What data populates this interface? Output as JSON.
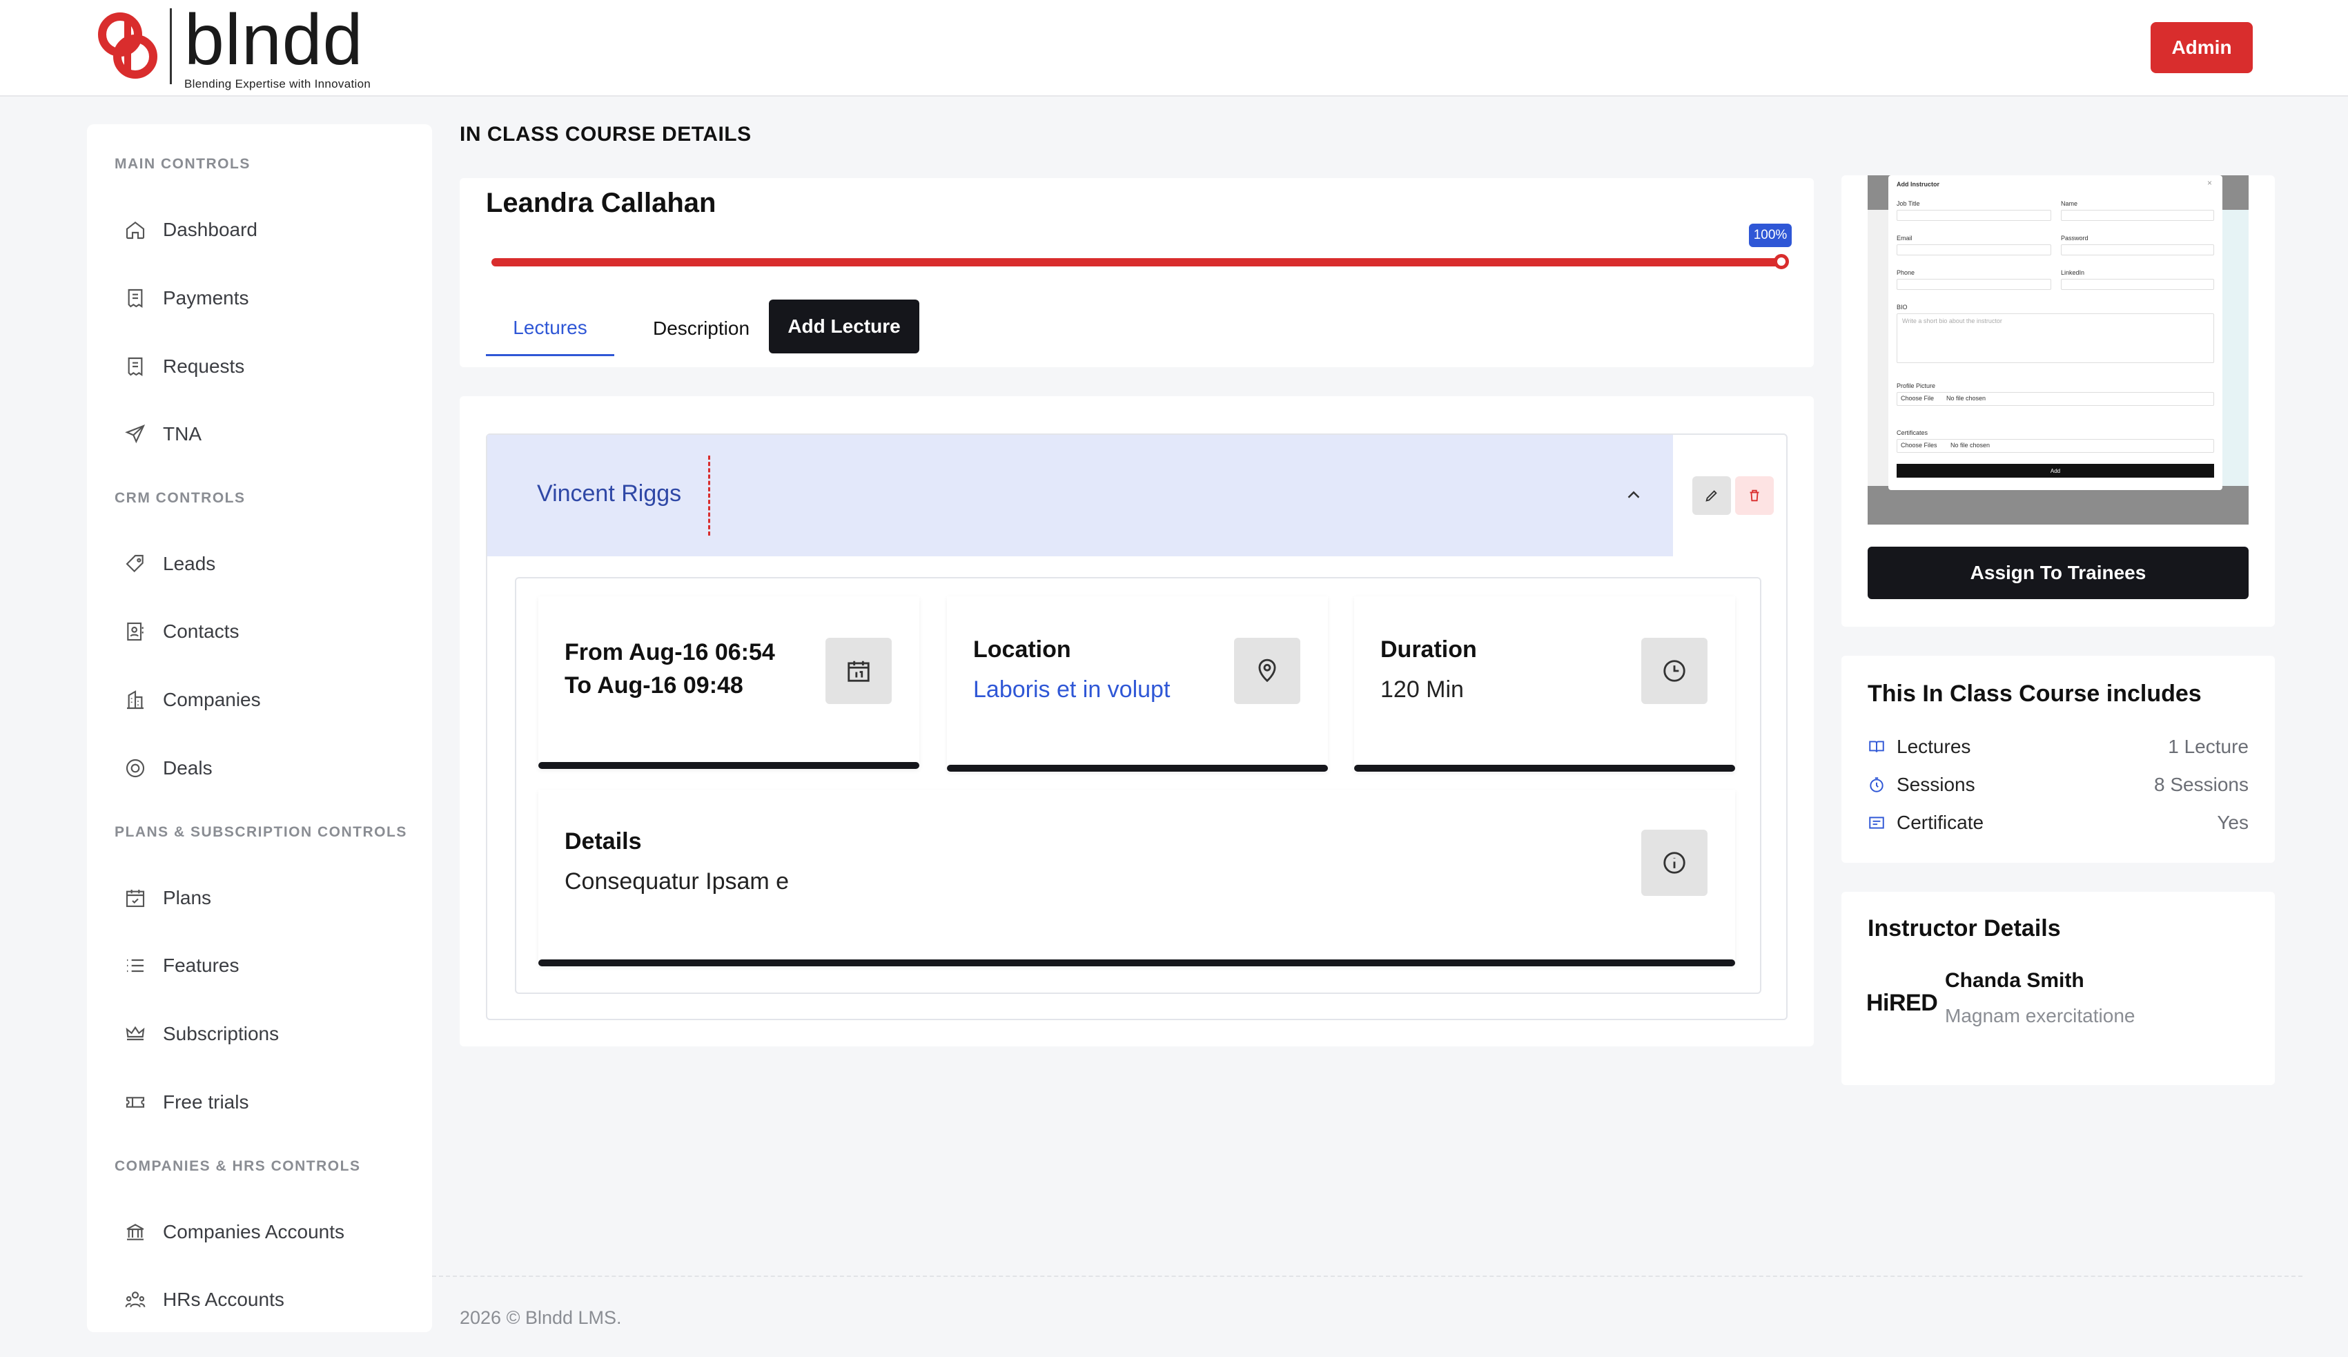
{
  "header": {
    "brand": "blndd",
    "tagline": "Blending Expertise with Innovation",
    "admin_label": "Admin"
  },
  "sidebar": {
    "sections": [
      {
        "title": "MAIN CONTROLS",
        "items": [
          "Dashboard",
          "Payments",
          "Requests",
          "TNA"
        ]
      },
      {
        "title": "CRM CONTROLS",
        "items": [
          "Leads",
          "Contacts",
          "Companies",
          "Deals"
        ]
      },
      {
        "title": "PLANS & SUBSCRIPTION CONTROLS",
        "items": [
          "Plans",
          "Features",
          "Subscriptions",
          "Free trials"
        ]
      },
      {
        "title": "COMPANIES & HRS CONTROLS",
        "items": [
          "Companies Accounts",
          "HRs Accounts"
        ]
      }
    ]
  },
  "page": {
    "title": "IN CLASS COURSE DETAILS"
  },
  "course": {
    "name": "Leandra Callahan",
    "progress": 100,
    "progress_label": "100%",
    "tabs": {
      "lectures": "Lectures",
      "description": "Description"
    },
    "add_lecture_label": "Add Lecture"
  },
  "lecture": {
    "title": "Vincent Riggs",
    "from": "From Aug-16 06:54",
    "to": "To Aug-16 09:48",
    "location_title": "Location",
    "location_value": "Laboris et in volupt",
    "duration_title": "Duration",
    "duration_value": "120 Min",
    "details_title": "Details",
    "details_value": "Consequatur Ipsam e"
  },
  "preview": {
    "modal_title": "Add Instructor",
    "fields": {
      "job_title": "Job Title",
      "name": "Name",
      "email": "Email",
      "password": "Password",
      "phone": "Phone",
      "linkedin": "LinkedIn",
      "bio": "BIO",
      "bio_placeholder": "Write a short bio about the instructor",
      "profile_picture": "Profile Picture",
      "certificates": "Certificates",
      "choose_file": "Choose File",
      "choose_files": "Choose Files",
      "no_file": "No file chosen",
      "add": "Add"
    },
    "assign_label": "Assign To Trainees"
  },
  "includes": {
    "title": "This In Class Course includes",
    "rows": [
      {
        "label": "Lectures",
        "value": "1 Lecture",
        "icon": "book-icon"
      },
      {
        "label": "Sessions",
        "value": "8 Sessions",
        "icon": "timer-icon"
      },
      {
        "label": "Certificate",
        "value": "Yes",
        "icon": "certificate-icon"
      }
    ]
  },
  "instructor": {
    "title": "Instructor Details",
    "logo_text": "HiRED",
    "name": "Chanda Smith",
    "role": "Magnam exercitatione"
  },
  "footer": {
    "text": "2026 © Blndd LMS."
  },
  "colors": {
    "accent": "#2f57d6",
    "brand_red": "#d92d2d",
    "dark": "#15161b"
  }
}
